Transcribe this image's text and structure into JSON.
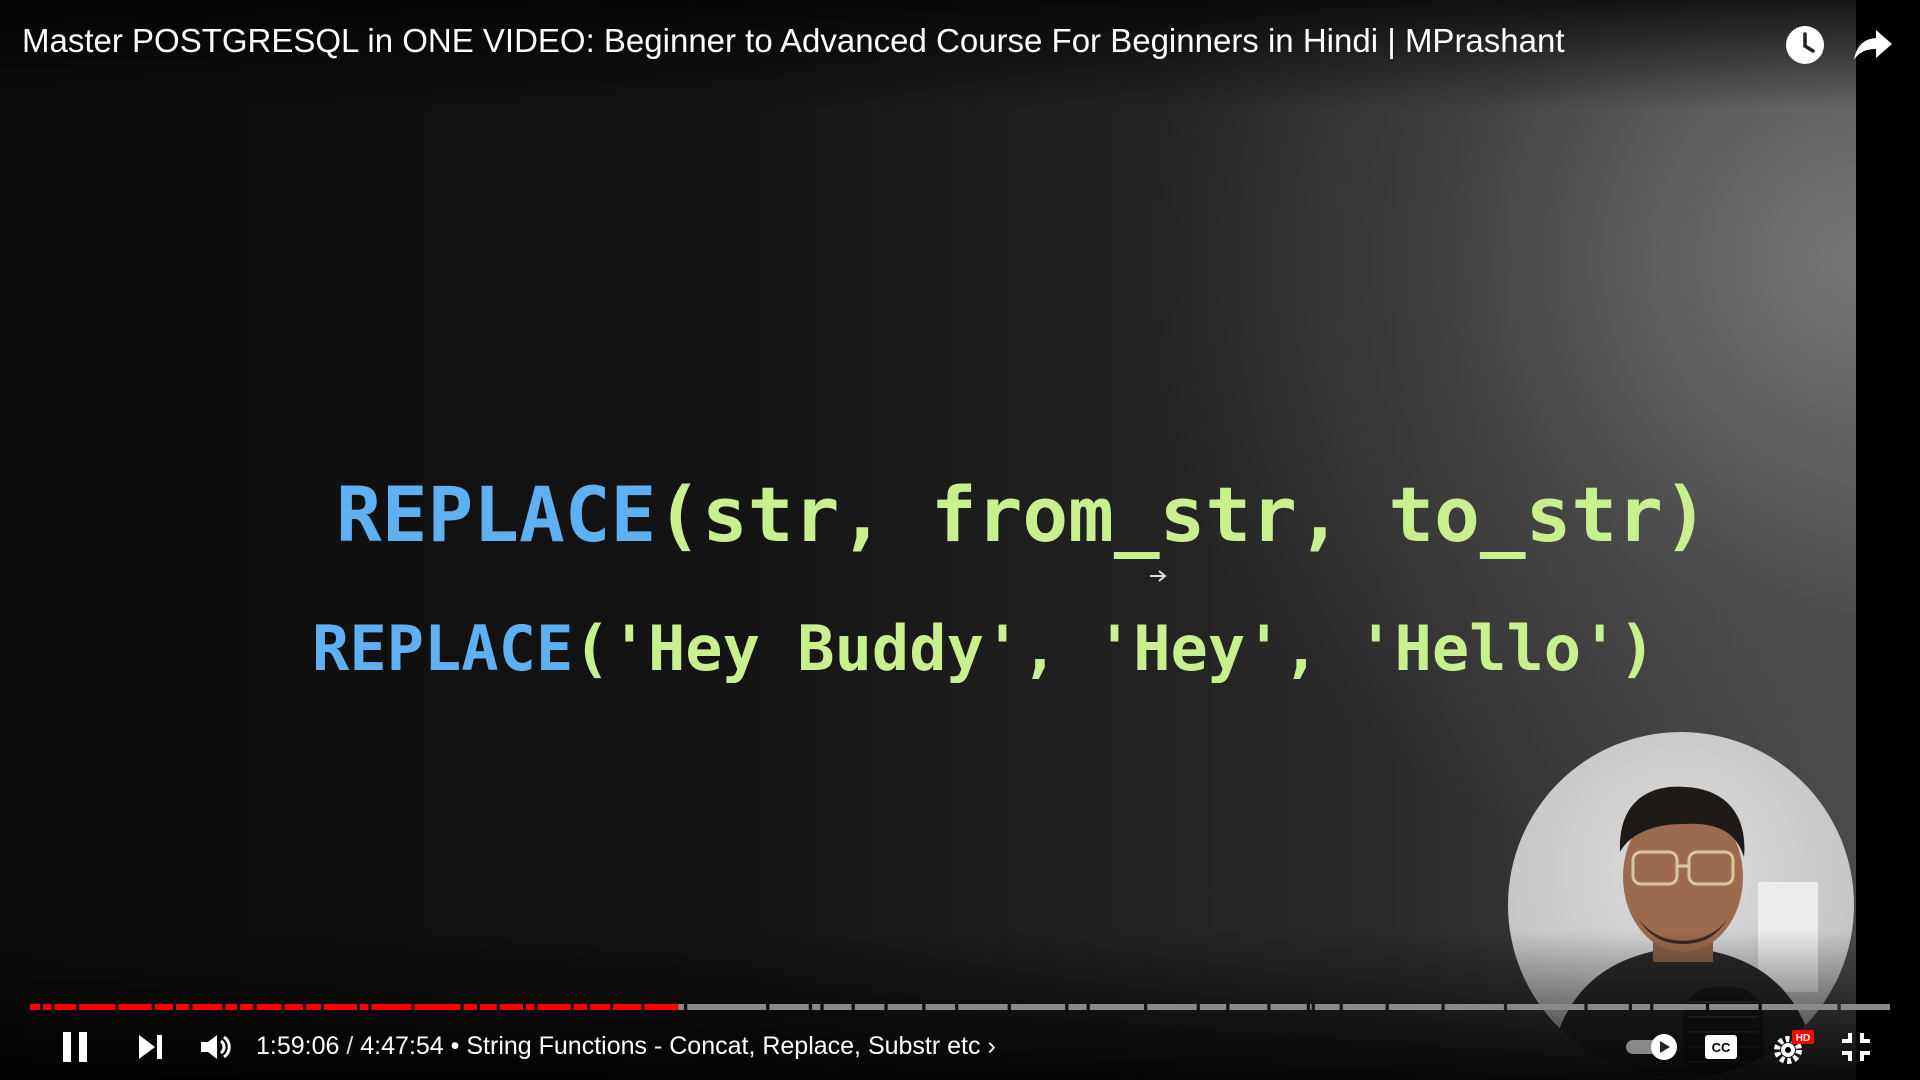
{
  "video": {
    "title": "Master POSTGRESQL in ONE VIDEO: Beginner to Advanced Course For Beginners in Hindi | MPrashant"
  },
  "slide": {
    "line1_func": "REPLACE",
    "line1_args": "(str, from_str, to_str)",
    "line2_func": "REPLACE",
    "line2_args": "('Hey Buddy', 'Hey', 'Hello')"
  },
  "player": {
    "current_time": "1:59:06",
    "separator": "/",
    "duration": "4:47:54",
    "bullet": "•",
    "chapter": "String Functions - Concat, Replace, Substr etc",
    "chapter_chevron": "›",
    "progress_played_fraction": 0.3486,
    "colors": {
      "played": "#ff0000",
      "unplayed": "#8a8a8a",
      "text": "#ffffff",
      "hd_badge": "#ff0000"
    },
    "cc_label": "CC",
    "hd_label": "HD"
  },
  "icons": {
    "watch_later": "clock-icon",
    "share": "share-icon",
    "pause": "pause-icon",
    "next": "next-icon",
    "volume": "volume-icon",
    "autoplay": "autoplay-toggle-icon",
    "captions": "cc-icon",
    "settings": "gear-icon",
    "exit_fullscreen": "exit-fullscreen-icon"
  }
}
